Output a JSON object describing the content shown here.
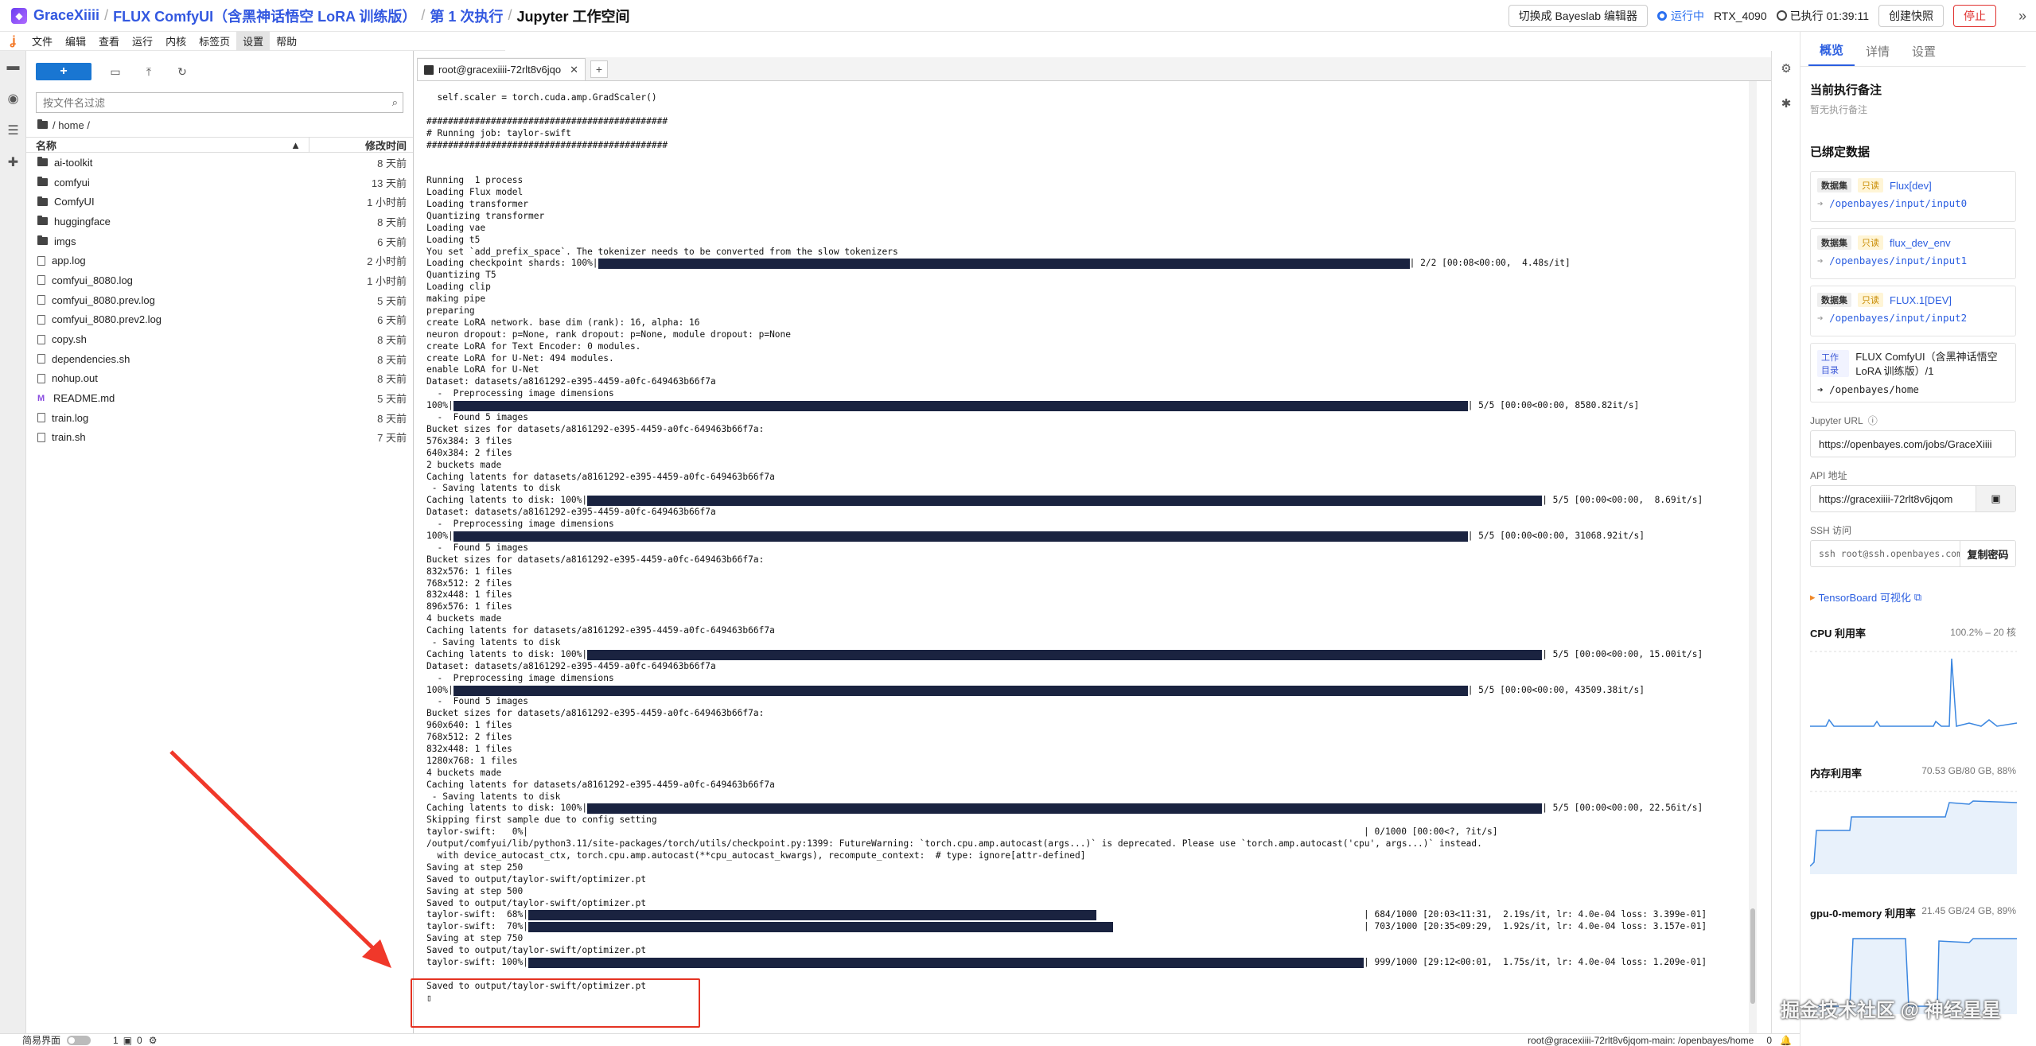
{
  "header": {
    "user": "GraceXiiii",
    "project": "FLUX ComfyUI（含黑神话悟空 LoRA 训练版）",
    "execution": "第 1 次执行",
    "workspace": "Jupyter 工作空间",
    "switch_label": "切换成 Bayeslab 编辑器",
    "status": "运行中",
    "gpu": "RTX_4090",
    "exec_time": "已执行 01:39:11",
    "snapshot_label": "创建快照",
    "stop_label": "停止",
    "collapse_icon": "chevron-double-right-icon"
  },
  "menu": [
    "文件",
    "编辑",
    "查看",
    "运行",
    "内核",
    "标签页",
    "设置",
    "帮助"
  ],
  "filebrowser": {
    "new_label": "+",
    "search_placeholder": "按文件名过滤",
    "path": "/ home /",
    "col_name": "名称",
    "col_modified": "修改时间",
    "rows": [
      {
        "name": "ai-toolkit",
        "mod": "8 天前",
        "type": "folder"
      },
      {
        "name": "comfyui",
        "mod": "13 天前",
        "type": "folder"
      },
      {
        "name": "ComfyUI",
        "mod": "1 小时前",
        "type": "folder"
      },
      {
        "name": "huggingface",
        "mod": "8 天前",
        "type": "folder"
      },
      {
        "name": "imgs",
        "mod": "6 天前",
        "type": "folder"
      },
      {
        "name": "app.log",
        "mod": "2 小时前",
        "type": "file"
      },
      {
        "name": "comfyui_8080.log",
        "mod": "1 小时前",
        "type": "file"
      },
      {
        "name": "comfyui_8080.prev.log",
        "mod": "5 天前",
        "type": "file"
      },
      {
        "name": "comfyui_8080.prev2.log",
        "mod": "6 天前",
        "type": "file"
      },
      {
        "name": "copy.sh",
        "mod": "8 天前",
        "type": "file"
      },
      {
        "name": "dependencies.sh",
        "mod": "8 天前",
        "type": "file"
      },
      {
        "name": "nohup.out",
        "mod": "8 天前",
        "type": "file"
      },
      {
        "name": "README.md",
        "mod": "5 天前",
        "type": "md"
      },
      {
        "name": "train.log",
        "mod": "8 天前",
        "type": "file"
      },
      {
        "name": "train.sh",
        "mod": "7 天前",
        "type": "file"
      }
    ]
  },
  "terminal": {
    "tab_label": "root@gracexiiii-72rlt8v6jqo",
    "lines": [
      {
        "t": "  self.scaler = torch.cuda.amp.GradScaler()"
      },
      {
        "t": ""
      },
      {
        "t": "#############################################"
      },
      {
        "t": "# Running job: taylor-swift"
      },
      {
        "t": "#############################################"
      },
      {
        "t": ""
      },
      {
        "t": ""
      },
      {
        "t": "Running  1 process"
      },
      {
        "t": "Loading Flux model"
      },
      {
        "t": "Loading transformer"
      },
      {
        "t": "Quantizing transformer"
      },
      {
        "t": "Loading vae"
      },
      {
        "t": "Loading t5"
      },
      {
        "t": "You set `add_prefix_space`. The tokenizer needs to be converted from the slow tokenizers"
      },
      {
        "t": "Loading checkpoint shards: 100%|",
        "bar": [
          1,
          0.68
        ],
        "end": "| 2/2 [00:08<00:00,  4.48s/it]"
      },
      {
        "t": "Quantizing T5"
      },
      {
        "t": "Loading clip"
      },
      {
        "t": "making pipe"
      },
      {
        "t": "preparing"
      },
      {
        "t": "create LoRA network. base dim (rank): 16, alpha: 16"
      },
      {
        "t": "neuron dropout: p=None, rank dropout: p=None, module dropout: p=None"
      },
      {
        "t": "create LoRA for Text Encoder: 0 modules."
      },
      {
        "t": "create LoRA for U-Net: 494 modules."
      },
      {
        "t": "enable LoRA for U-Net"
      },
      {
        "t": "Dataset: datasets/a8161292-e395-4459-a0fc-649463b66f7a"
      },
      {
        "t": "  -  Preprocessing image dimensions"
      },
      {
        "t": "100%|",
        "bar": [
          1,
          0.85
        ],
        "end": "| 5/5 [00:00<00:00, 8580.82it/s]"
      },
      {
        "t": "  -  Found 5 images"
      },
      {
        "t": "Bucket sizes for datasets/a8161292-e395-4459-a0fc-649463b66f7a:"
      },
      {
        "t": "576x384: 3 files"
      },
      {
        "t": "640x384: 2 files"
      },
      {
        "t": "2 buckets made"
      },
      {
        "t": "Caching latents for datasets/a8161292-e395-4459-a0fc-649463b66f7a"
      },
      {
        "t": " - Saving latents to disk"
      },
      {
        "t": "Caching latents to disk: 100%|",
        "bar": [
          1,
          0.8
        ],
        "end": "| 5/5 [00:00<00:00,  8.69it/s]"
      },
      {
        "t": "Dataset: datasets/a8161292-e395-4459-a0fc-649463b66f7a"
      },
      {
        "t": "  -  Preprocessing image dimensions"
      },
      {
        "t": "100%|",
        "bar": [
          1,
          0.85
        ],
        "end": "| 5/5 [00:00<00:00, 31068.92it/s]"
      },
      {
        "t": "  -  Found 5 images"
      },
      {
        "t": "Bucket sizes for datasets/a8161292-e395-4459-a0fc-649463b66f7a:"
      },
      {
        "t": "832x576: 1 files"
      },
      {
        "t": "768x512: 2 files"
      },
      {
        "t": "832x448: 1 files"
      },
      {
        "t": "896x576: 1 files"
      },
      {
        "t": "4 buckets made"
      },
      {
        "t": "Caching latents for datasets/a8161292-e395-4459-a0fc-649463b66f7a"
      },
      {
        "t": " - Saving latents to disk"
      },
      {
        "t": "Caching latents to disk: 100%|",
        "bar": [
          1,
          0.8
        ],
        "end": "| 5/5 [00:00<00:00, 15.00it/s]"
      },
      {
        "t": "Dataset: datasets/a8161292-e395-4459-a0fc-649463b66f7a"
      },
      {
        "t": "  -  Preprocessing image dimensions"
      },
      {
        "t": "100%|",
        "bar": [
          1,
          0.85
        ],
        "end": "| 5/5 [00:00<00:00, 43509.38it/s]"
      },
      {
        "t": "  -  Found 5 images"
      },
      {
        "t": "Bucket sizes for datasets/a8161292-e395-4459-a0fc-649463b66f7a:"
      },
      {
        "t": "960x640: 1 files"
      },
      {
        "t": "768x512: 2 files"
      },
      {
        "t": "832x448: 1 files"
      },
      {
        "t": "1280x768: 1 files"
      },
      {
        "t": "4 buckets made"
      },
      {
        "t": "Caching latents for datasets/a8161292-e395-4459-a0fc-649463b66f7a"
      },
      {
        "t": " - Saving latents to disk"
      },
      {
        "t": "Caching latents to disk: 100%|",
        "bar": [
          1,
          0.8
        ],
        "end": "| 5/5 [00:00<00:00, 22.56it/s]"
      },
      {
        "t": "Skipping first sample due to config setting"
      },
      {
        "t": "taylor-swift:   0%|",
        "bar": [
          0,
          0.7
        ],
        "end": "| 0/1000 [00:00<?, ?it/s]"
      },
      {
        "t": "/output/comfyui/lib/python3.11/site-packages/torch/utils/checkpoint.py:1399: FutureWarning: `torch.cpu.amp.autocast(args...)` is deprecated. Please use `torch.amp.autocast('cpu', args...)` instead."
      },
      {
        "t": "  with device_autocast_ctx, torch.cpu.amp.autocast(**cpu_autocast_kwargs), recompute_context:  # type: ignore[attr-defined]"
      },
      {
        "t": "Saving at step 250"
      },
      {
        "t": "Saved to output/taylor-swift/optimizer.pt"
      },
      {
        "t": "Saving at step 500"
      },
      {
        "t": "Saved to output/taylor-swift/optimizer.pt"
      },
      {
        "t": "taylor-swift:  68%|",
        "bar": [
          0.68,
          0.7
        ],
        "end": "| 684/1000 [20:03<11:31,  2.19s/it, lr: 4.0e-04 loss: 3.399e-01]"
      },
      {
        "t": "taylor-swift:  70%|",
        "bar": [
          0.7,
          0.7
        ],
        "end": "| 703/1000 [20:35<09:29,  1.92s/it, lr: 4.0e-04 loss: 3.157e-01]"
      },
      {
        "t": "Saving at step 750"
      },
      {
        "t": "Saved to output/taylor-swift/optimizer.pt"
      },
      {
        "t": "taylor-swift: 100%|",
        "bar": [
          1,
          0.7
        ],
        "end": "| 999/1000 [29:12<00:01,  1.75s/it, lr: 4.0e-04 loss: 1.209e-01]"
      },
      {
        "t": ""
      },
      {
        "t": "Saved to output/taylor-swift/optimizer.pt"
      },
      {
        "t": "▯"
      }
    ]
  },
  "rpanel": {
    "tabs": [
      "概览",
      "详情",
      "设置"
    ],
    "note_title": "当前执行备注",
    "note_empty": "暂无执行备注",
    "bound_title": "已绑定数据",
    "datasets": [
      {
        "kind": "数据集",
        "ro": "只读",
        "name": "Flux[dev]",
        "path": "/openbayes/input/input0"
      },
      {
        "kind": "数据集",
        "ro": "只读",
        "name": "flux_dev_env",
        "path": "/openbayes/input/input1"
      },
      {
        "kind": "数据集",
        "ro": "只读",
        "name": "FLUX.1[DEV]",
        "path": "/openbayes/input/input2"
      }
    ],
    "workdir": {
      "kind": "工作目录",
      "name": "FLUX ComfyUI（含黑神话悟空 LoRA 训练版）/1",
      "path": "/openbayes/home"
    },
    "jupyter_label": "Jupyter URL",
    "jupyter_url": "https://openbayes.com/jobs/GraceXiiii",
    "api_label": "API 地址",
    "api_url": "https://gracexiiii-72rlt8v6jqom",
    "ssh_label": "SSH 访问",
    "ssh_cmd": "ssh root@ssh.openbayes.com",
    "copy_pw": "复制密码",
    "tensorboard": "TensorBoard 可视化",
    "cpu_title": "CPU 利用率",
    "cpu_value": "100.2% – 20 核",
    "mem_title": "内存利用率",
    "mem_value": "70.53 GB/80 GB, 88%",
    "gpu_title": "gpu-0-memory 利用率",
    "gpu_value": "21.45 GB/24 GB, 89%"
  },
  "statusbar": {
    "simple_mode": "简易界面",
    "count1": "1",
    "count2": "0",
    "right": "root@gracexiiii-72rlt8v6jqom-main: /openbayes/home",
    "right_num": "0"
  },
  "watermark": "掘金技术社区 @ 神经星星"
}
